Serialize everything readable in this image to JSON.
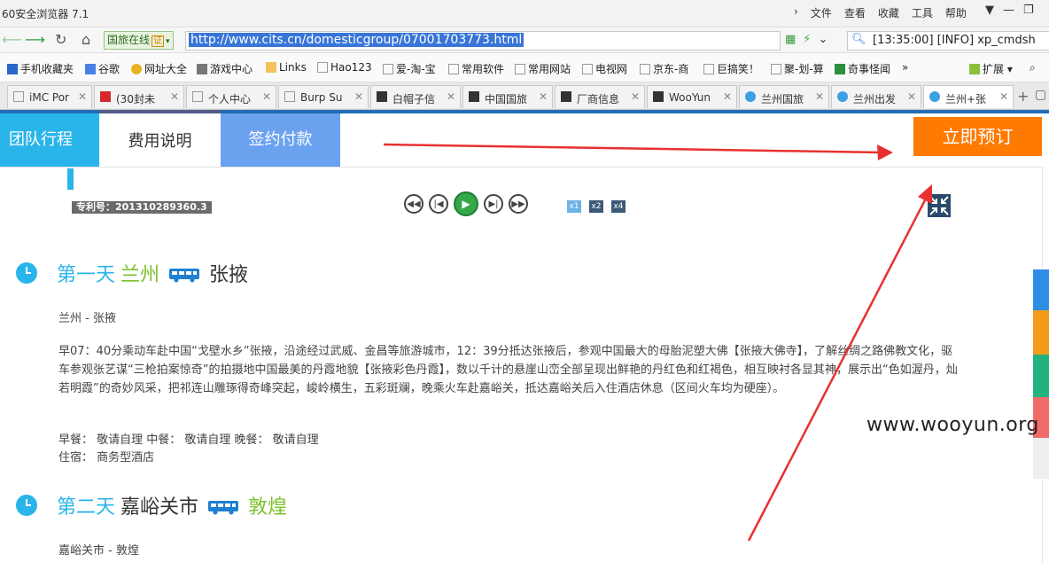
{
  "browser": {
    "title": "60安全浏览器 7.1",
    "menu": [
      "文件",
      "查看",
      "收藏",
      "工具",
      "帮助"
    ],
    "site_badge": "国旅在线",
    "cert_label": "证",
    "url": "http://www.cits.cn/domesticgroup/07001703773.html",
    "search_text": "[13:35:00] [INFO] xp_cmdsh"
  },
  "bookmarks": [
    {
      "label": "手机收藏夹"
    },
    {
      "label": "谷歌"
    },
    {
      "label": "网址大全"
    },
    {
      "label": "游戏中心"
    },
    {
      "label": "Links"
    },
    {
      "label": "Hao123"
    },
    {
      "label": "爱-淘-宝"
    },
    {
      "label": "常用软件"
    },
    {
      "label": "常用网站"
    },
    {
      "label": "电视网"
    },
    {
      "label": "京东-商"
    },
    {
      "label": "巨搞笑！"
    },
    {
      "label": "聚-划-算"
    },
    {
      "label": "奇事怪闻"
    }
  ],
  "bookmarks_more": "»",
  "extend_label": "扩展",
  "tabs": [
    {
      "label": "iMC Por"
    },
    {
      "label": "(30封未"
    },
    {
      "label": "个人中心"
    },
    {
      "label": "Burp Su"
    },
    {
      "label": "白帽子信"
    },
    {
      "label": "中国国旅"
    },
    {
      "label": "厂商信息"
    },
    {
      "label": "WooYun"
    },
    {
      "label": "兰州国旅"
    },
    {
      "label": "兰州出发"
    },
    {
      "label": "兰州+张"
    }
  ],
  "page": {
    "nav_tabs": [
      "团队行程",
      "费用说明",
      "签约付款"
    ],
    "book_button": "立即预订",
    "patent": "专利号：201310289360.3",
    "speeds": [
      "x1",
      "x2",
      "x4"
    ],
    "days": [
      {
        "day": "第一天",
        "from": "兰州",
        "to": "张掖",
        "route": "兰州 - 张掖",
        "desc": "早07：40分乘动车赴中国“戈壁水乡”张掖，沿途经过武威、金昌等旅游城市，12：39分抵达张掖后，参观中国最大的母胎泥塑大佛【张掖大佛寺】，了解丝绸之路佛教文化，驱车参观张艺谋“三枪拍案惊奇”的拍摄地中国最美的丹霞地貌【张掖彩色丹霞】，数以千计的悬崖山峦全部呈现出鲜艳的丹红色和红褐色，相互映衬各显其神，展示出“色如渥丹，灿若明霞”的奇妙风采，把祁连山雕琢得奇峰突起，峻岭横生，五彩斑斓，晚乘火车赴嘉峪关，抵达嘉峪关后入住酒店休息（区间火车均为硬座）。",
        "meals": "早餐： 敬请自理  中餐： 敬请自理  晚餐： 敬请自理",
        "hotel": "住宿： 商务型酒店"
      },
      {
        "day": "第二天",
        "from": "嘉峪关市",
        "to": "敦煌",
        "route": "嘉峪关市 - 敦煌"
      }
    ]
  },
  "watermark": "www.wooyun.org",
  "colors": {
    "accent_blue": "#29b5ea",
    "green": "#7cc12a",
    "orange": "#ff7a00",
    "arrow_red": "#e8312f"
  }
}
